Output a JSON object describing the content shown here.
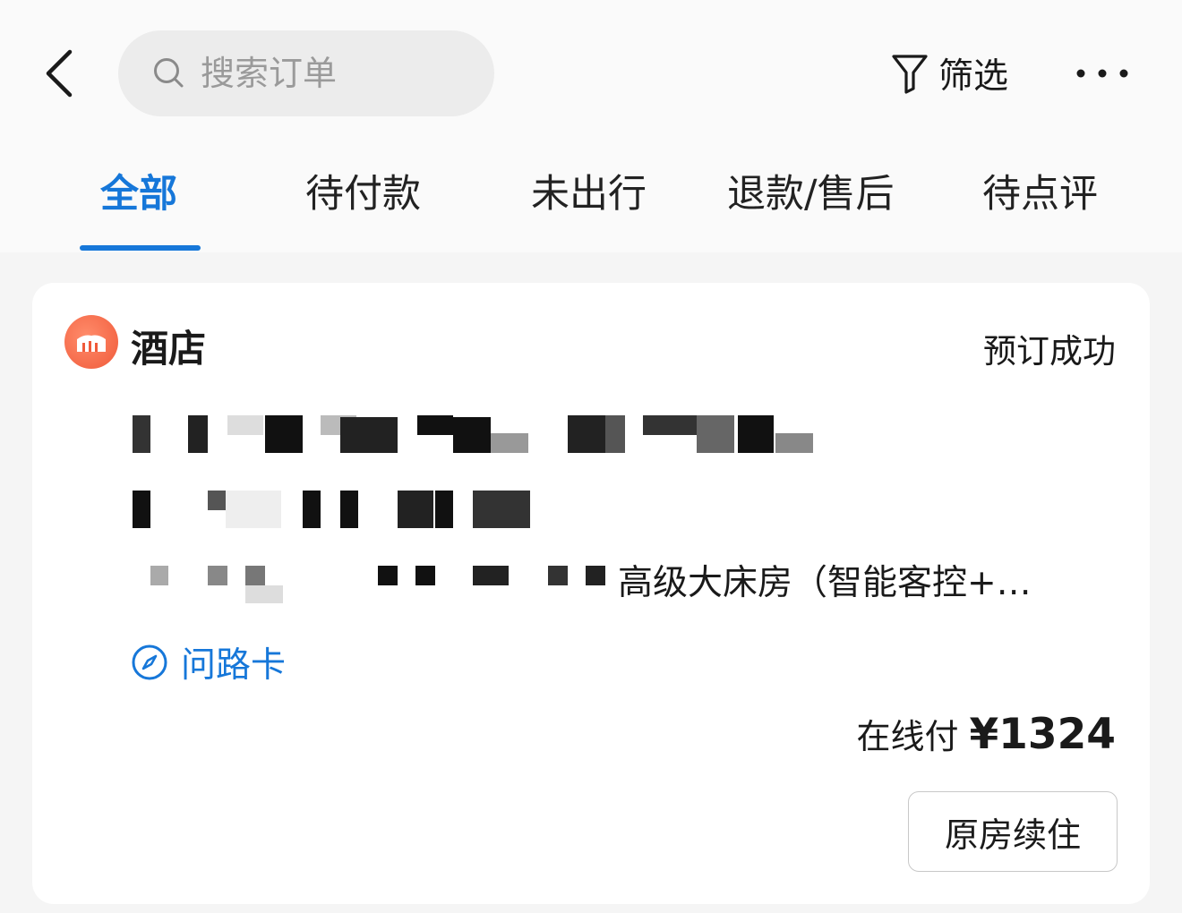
{
  "header": {
    "search_placeholder": "搜索订单",
    "filter_label": "筛选"
  },
  "tabs": [
    {
      "label": "全部",
      "active": true
    },
    {
      "label": "待付款",
      "active": false
    },
    {
      "label": "未出行",
      "active": false
    },
    {
      "label": "退款/售后",
      "active": false
    },
    {
      "label": "待点评",
      "active": false
    }
  ],
  "order": {
    "category": "酒店",
    "status": "预订成功",
    "room_type": "高级大床房（智能客控+…",
    "route_card_label": "问路卡",
    "payment_method": "在线付",
    "price": "¥1324",
    "action_label": "原房续住"
  },
  "colors": {
    "accent": "#1677d9",
    "hotel_logo": "#f05a3a"
  }
}
